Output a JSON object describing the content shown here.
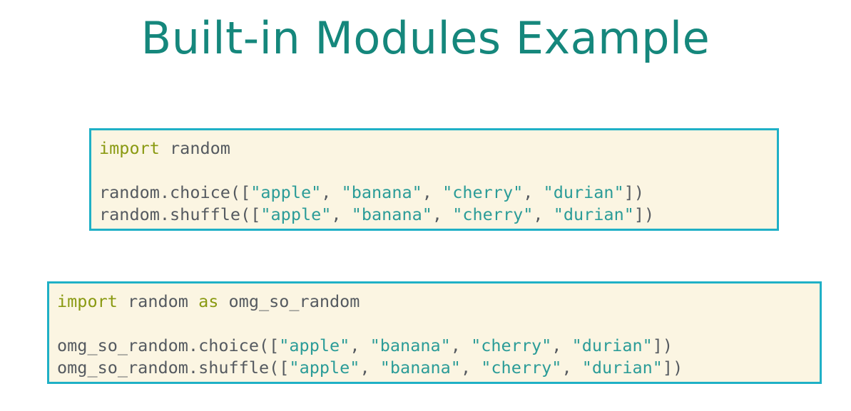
{
  "title": "Built-in Modules Example",
  "colors": {
    "title": "#15877c",
    "box_border": "#1fb0c6",
    "box_background": "#fbf5e2",
    "keyword": "#8a9a12",
    "string": "#2b9c98",
    "plain": "#555a60"
  },
  "code_blocks": [
    {
      "lines": [
        {
          "tokens": [
            {
              "t": "kw",
              "v": "import"
            },
            {
              "t": "pl",
              "v": " random"
            }
          ]
        },
        {
          "tokens": []
        },
        {
          "tokens": [
            {
              "t": "pl",
              "v": "random.choice(["
            },
            {
              "t": "str",
              "v": "\"apple\""
            },
            {
              "t": "pl",
              "v": ", "
            },
            {
              "t": "str",
              "v": "\"banana\""
            },
            {
              "t": "pl",
              "v": ", "
            },
            {
              "t": "str",
              "v": "\"cherry\""
            },
            {
              "t": "pl",
              "v": ", "
            },
            {
              "t": "str",
              "v": "\"durian\""
            },
            {
              "t": "pl",
              "v": "])"
            }
          ]
        },
        {
          "tokens": [
            {
              "t": "pl",
              "v": "random.shuffle(["
            },
            {
              "t": "str",
              "v": "\"apple\""
            },
            {
              "t": "pl",
              "v": ", "
            },
            {
              "t": "str",
              "v": "\"banana\""
            },
            {
              "t": "pl",
              "v": ", "
            },
            {
              "t": "str",
              "v": "\"cherry\""
            },
            {
              "t": "pl",
              "v": ", "
            },
            {
              "t": "str",
              "v": "\"durian\""
            },
            {
              "t": "pl",
              "v": "])"
            }
          ]
        }
      ]
    },
    {
      "lines": [
        {
          "tokens": [
            {
              "t": "kw",
              "v": "import"
            },
            {
              "t": "pl",
              "v": " random "
            },
            {
              "t": "kw",
              "v": "as"
            },
            {
              "t": "pl",
              "v": " omg_so_random"
            }
          ]
        },
        {
          "tokens": []
        },
        {
          "tokens": [
            {
              "t": "pl",
              "v": "omg_so_random.choice(["
            },
            {
              "t": "str",
              "v": "\"apple\""
            },
            {
              "t": "pl",
              "v": ", "
            },
            {
              "t": "str",
              "v": "\"banana\""
            },
            {
              "t": "pl",
              "v": ", "
            },
            {
              "t": "str",
              "v": "\"cherry\""
            },
            {
              "t": "pl",
              "v": ", "
            },
            {
              "t": "str",
              "v": "\"durian\""
            },
            {
              "t": "pl",
              "v": "])"
            }
          ]
        },
        {
          "tokens": [
            {
              "t": "pl",
              "v": "omg_so_random.shuffle(["
            },
            {
              "t": "str",
              "v": "\"apple\""
            },
            {
              "t": "pl",
              "v": ", "
            },
            {
              "t": "str",
              "v": "\"banana\""
            },
            {
              "t": "pl",
              "v": ", "
            },
            {
              "t": "str",
              "v": "\"cherry\""
            },
            {
              "t": "pl",
              "v": ", "
            },
            {
              "t": "str",
              "v": "\"durian\""
            },
            {
              "t": "pl",
              "v": "])"
            }
          ]
        }
      ]
    }
  ]
}
